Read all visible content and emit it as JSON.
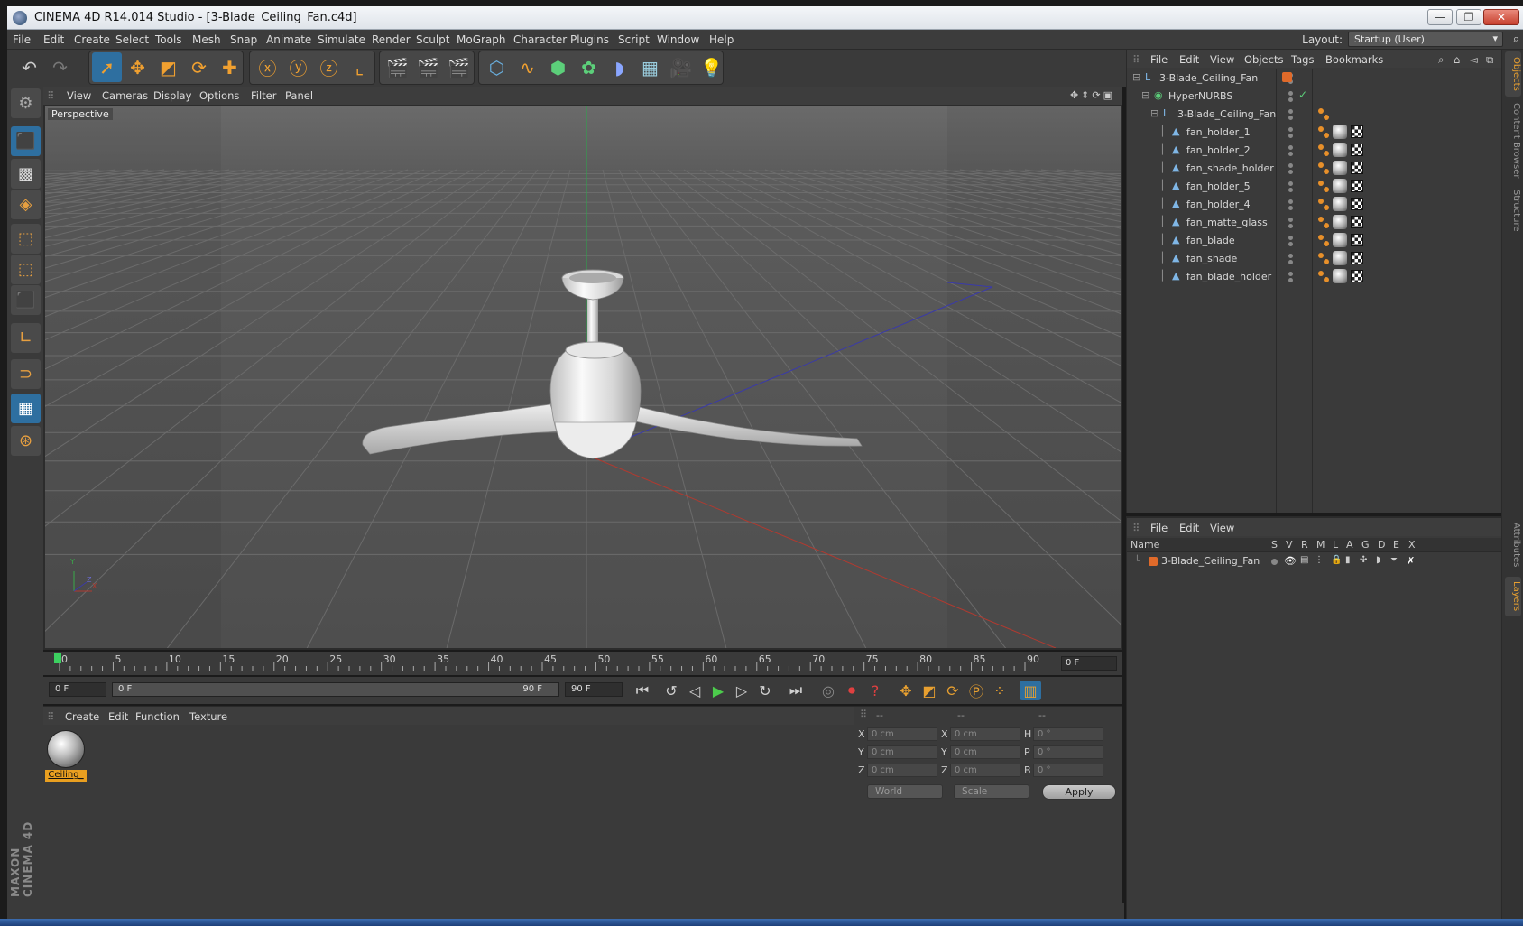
{
  "window": {
    "title": "CINEMA 4D R14.014 Studio - [3-Blade_Ceiling_Fan.c4d]",
    "minimize": "—",
    "restore": "❐",
    "close": "✕"
  },
  "menubar": {
    "items": [
      "File",
      "Edit",
      "Create",
      "Select",
      "Tools",
      "Mesh",
      "Snap",
      "Animate",
      "Simulate",
      "Render",
      "Sculpt",
      "MoGraph",
      "Character",
      "Plugins",
      "Script",
      "Window",
      "Help"
    ],
    "layout_label": "Layout:",
    "layout_value": "Startup (User)"
  },
  "viewport": {
    "menu": [
      "View",
      "Cameras",
      "Display",
      "Options",
      "Filter",
      "Panel"
    ],
    "label": "Perspective",
    "axis_x": "X",
    "axis_y": "Y",
    "axis_z": "Z"
  },
  "timeline": {
    "ticks": [
      "0",
      "5",
      "10",
      "15",
      "20",
      "25",
      "30",
      "35",
      "40",
      "45",
      "50",
      "55",
      "60",
      "65",
      "70",
      "75",
      "80",
      "85",
      "90"
    ],
    "current_frame": "0 F",
    "start_field": "0 F",
    "range_start": "0 F",
    "range_end": "90 F",
    "end_field": "90 F"
  },
  "materials": {
    "menu": [
      "Create",
      "Edit",
      "Function",
      "Texture"
    ],
    "items": [
      {
        "label": "Ceiling_"
      }
    ]
  },
  "coordinates": {
    "headers": [
      "--",
      "--",
      "--"
    ],
    "rows": [
      {
        "l1": "X",
        "v1": "0 cm",
        "l2": "X",
        "v2": "0 cm",
        "l3": "H",
        "v3": "0 °"
      },
      {
        "l1": "Y",
        "v1": "0 cm",
        "l2": "Y",
        "v2": "0 cm",
        "l3": "P",
        "v3": "0 °"
      },
      {
        "l1": "Z",
        "v1": "0 cm",
        "l2": "Z",
        "v2": "0 cm",
        "l3": "B",
        "v3": "0 °"
      }
    ],
    "mode": "World",
    "type": "Scale",
    "apply": "Apply"
  },
  "objects_panel": {
    "menu": [
      "File",
      "Edit",
      "View",
      "Objects",
      "Tags",
      "Bookmarks"
    ],
    "tree": [
      {
        "name": "3-Blade_Ceiling_Fan",
        "level": 0,
        "icon": "null-icon"
      },
      {
        "name": "HyperNURBS",
        "level": 1,
        "icon": "hypernurbs-icon"
      },
      {
        "name": "3-Blade_Ceiling_Fan",
        "level": 2,
        "icon": "null-icon"
      },
      {
        "name": "fan_holder_1",
        "level": 3,
        "icon": "polygon-icon"
      },
      {
        "name": "fan_holder_2",
        "level": 3,
        "icon": "polygon-icon"
      },
      {
        "name": "fan_shade_holder",
        "level": 3,
        "icon": "polygon-icon"
      },
      {
        "name": "fan_holder_5",
        "level": 3,
        "icon": "polygon-icon"
      },
      {
        "name": "fan_holder_4",
        "level": 3,
        "icon": "polygon-icon"
      },
      {
        "name": "fan_matte_glass",
        "level": 3,
        "icon": "polygon-icon"
      },
      {
        "name": "fan_blade",
        "level": 3,
        "icon": "polygon-icon"
      },
      {
        "name": "fan_shade",
        "level": 3,
        "icon": "polygon-icon"
      },
      {
        "name": "fan_blade_holder",
        "level": 3,
        "icon": "polygon-icon"
      }
    ]
  },
  "layers_panel": {
    "menu": [
      "File",
      "Edit",
      "View"
    ],
    "columns": [
      "Name",
      "S",
      "V",
      "R",
      "M",
      "L",
      "A",
      "G",
      "D",
      "E",
      "X"
    ],
    "rows": [
      {
        "name": "3-Blade_Ceiling_Fan"
      }
    ]
  },
  "sidetabs": [
    "Objects",
    "Content Browser",
    "Structure",
    "Attributes",
    "Layers"
  ],
  "brand": {
    "line1": "MAXON",
    "line2": "CINEMA 4D"
  },
  "colors": {
    "accent": "#e8a030",
    "selection": "#2e6fa0",
    "panel": "#3a3a3a",
    "viewport": "#555555"
  }
}
